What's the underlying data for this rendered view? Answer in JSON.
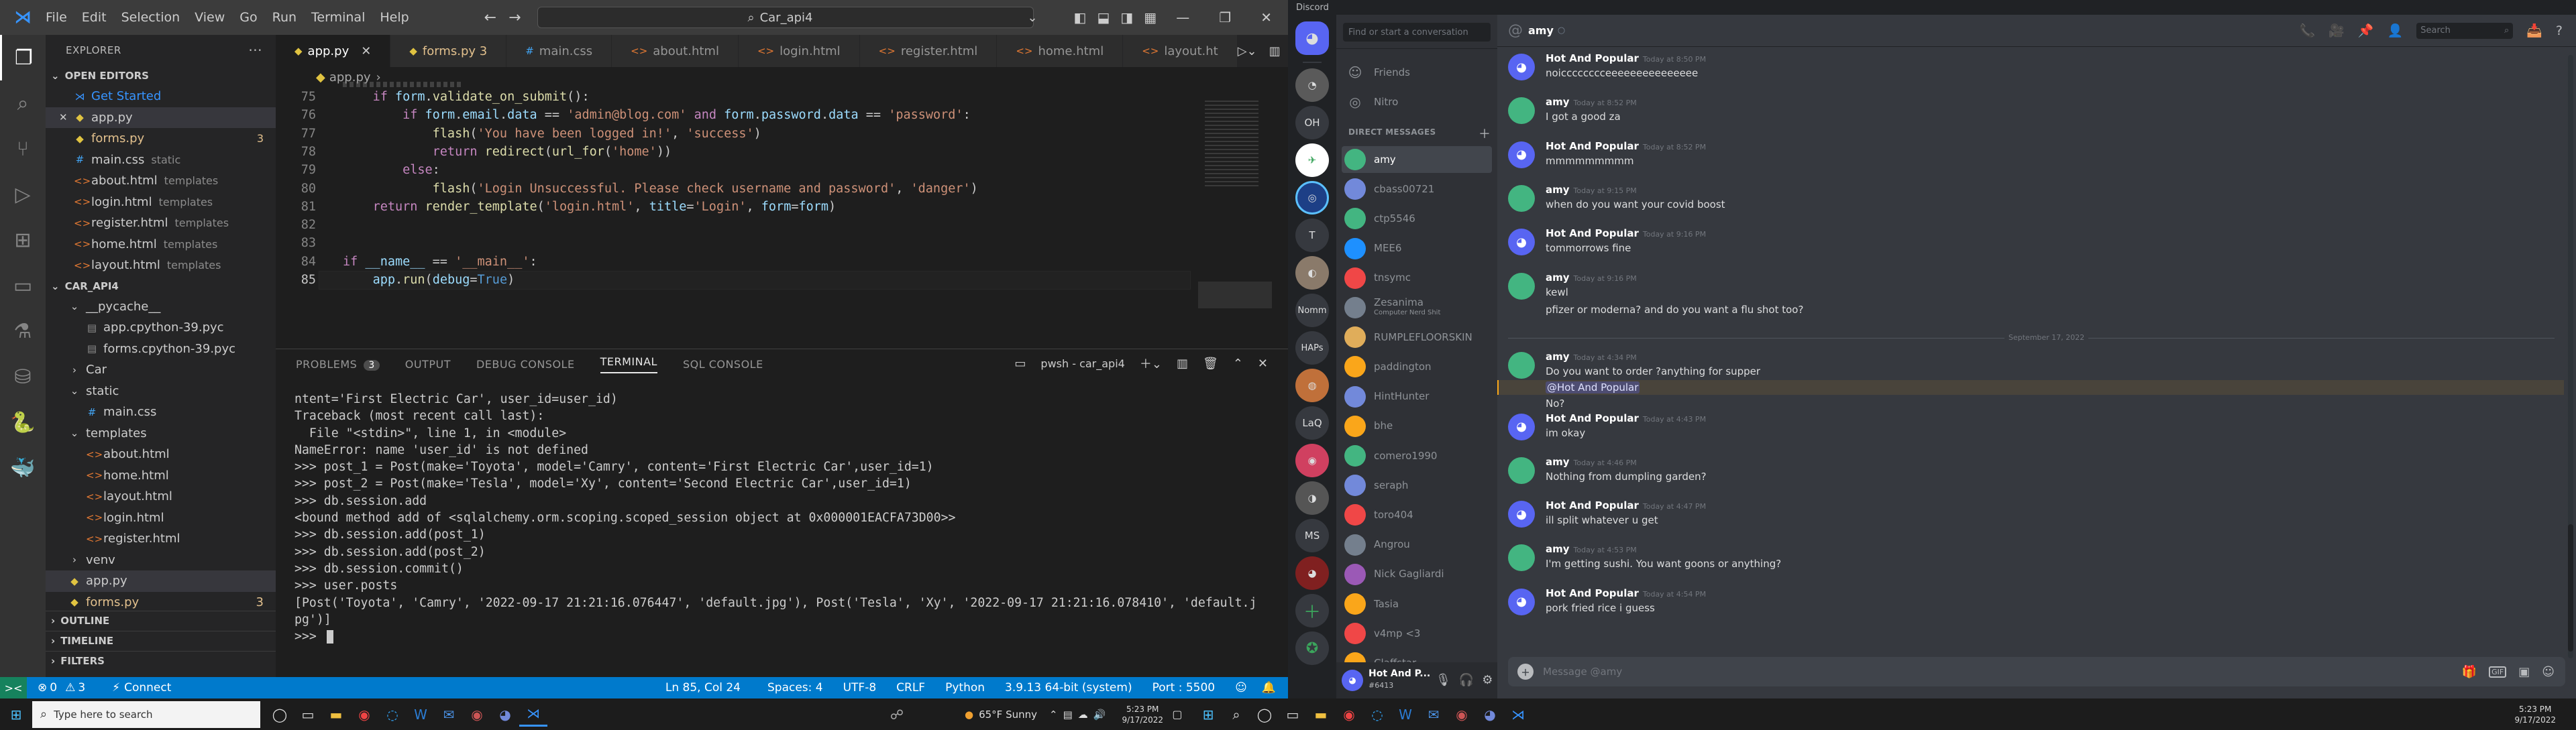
{
  "vscode": {
    "menu": [
      "File",
      "Edit",
      "Selection",
      "View",
      "Go",
      "Run",
      "Terminal",
      "Help"
    ],
    "search_text": "Car_api4",
    "explorer_title": "EXPLORER",
    "open_editors_label": "OPEN EDITORS",
    "open_editors": [
      {
        "name": "Get Started",
        "meta": "",
        "color": "#3794ff",
        "icon": "vscode-icon"
      },
      {
        "name": "app.py",
        "meta": "",
        "color": "#cccccc",
        "icon": "python-icon",
        "selected": true
      },
      {
        "name": "forms.py",
        "meta": "3",
        "color": "#e2c08d",
        "icon": "python-icon"
      },
      {
        "name": "main.css",
        "meta": "static",
        "color": "#cccccc",
        "icon": "css-icon"
      },
      {
        "name": "about.html",
        "meta": "templates",
        "color": "#cccccc",
        "icon": "html-icon"
      },
      {
        "name": "login.html",
        "meta": "templates",
        "color": "#cccccc",
        "icon": "html-icon"
      },
      {
        "name": "register.html",
        "meta": "templates",
        "color": "#cccccc",
        "icon": "html-icon"
      },
      {
        "name": "home.html",
        "meta": "templates",
        "color": "#cccccc",
        "icon": "html-icon"
      },
      {
        "name": "layout.html",
        "meta": "templates",
        "color": "#cccccc",
        "icon": "html-icon"
      }
    ],
    "project_label": "CAR_API4",
    "tree": [
      {
        "name": "__pycache__",
        "depth": 1,
        "type": "folder-open"
      },
      {
        "name": "app.cpython-39.pyc",
        "depth": 2,
        "type": "file"
      },
      {
        "name": "forms.cpython-39.pyc",
        "depth": 2,
        "type": "file"
      },
      {
        "name": "Car",
        "depth": 1,
        "type": "folder"
      },
      {
        "name": "static",
        "depth": 1,
        "type": "folder-open"
      },
      {
        "name": "main.css",
        "depth": 2,
        "type": "css"
      },
      {
        "name": "templates",
        "depth": 1,
        "type": "folder-open"
      },
      {
        "name": "about.html",
        "depth": 2,
        "type": "html"
      },
      {
        "name": "home.html",
        "depth": 2,
        "type": "html"
      },
      {
        "name": "layout.html",
        "depth": 2,
        "type": "html"
      },
      {
        "name": "login.html",
        "depth": 2,
        "type": "html"
      },
      {
        "name": "register.html",
        "depth": 2,
        "type": "html"
      },
      {
        "name": "venv",
        "depth": 1,
        "type": "folder"
      },
      {
        "name": "app.py",
        "depth": 1,
        "type": "python"
      },
      {
        "name": "forms.py",
        "depth": 1,
        "type": "python"
      }
    ],
    "outline_label": "OUTLINE",
    "timeline_label": "TIMELINE",
    "filters_label": "FILTERS",
    "tabs": [
      {
        "label": "app.py",
        "active": true,
        "icon": "python-icon"
      },
      {
        "label": "forms.py 3",
        "active": false,
        "icon": "python-icon"
      },
      {
        "label": "main.css",
        "active": false,
        "icon": "css-icon"
      },
      {
        "label": "about.html",
        "active": false,
        "icon": "html-icon"
      },
      {
        "label": "login.html",
        "active": false,
        "icon": "html-icon"
      },
      {
        "label": "register.html",
        "active": false,
        "icon": "html-icon"
      },
      {
        "label": "home.html",
        "active": false,
        "icon": "html-icon"
      },
      {
        "label": "layout.ht",
        "active": false,
        "icon": "html-icon"
      }
    ],
    "breadcrumb": "app.py",
    "code_lines": [
      {
        "n": "75",
        "t": "    if form.validate_on_submit():"
      },
      {
        "n": "76",
        "t": "        if form.email.data == 'admin@blog.com' and form.password.data == 'password':"
      },
      {
        "n": "77",
        "t": "            flash('You have been logged in!', 'success')"
      },
      {
        "n": "78",
        "t": "            return redirect(url_for('home'))"
      },
      {
        "n": "79",
        "t": "        else:"
      },
      {
        "n": "80",
        "t": "            flash('Login Unsuccessful. Please check username and password', 'danger')"
      },
      {
        "n": "81",
        "t": "    return render_template('login.html', title='Login', form=form)"
      },
      {
        "n": "82",
        "t": ""
      },
      {
        "n": "83",
        "t": ""
      },
      {
        "n": "84",
        "t": "if __name__ == '__main__':"
      },
      {
        "n": "85",
        "t": "    app.run(debug=True)"
      }
    ],
    "panel_tabs": [
      "PROBLEMS",
      "OUTPUT",
      "DEBUG CONSOLE",
      "TERMINAL",
      "SQL CONSOLE"
    ],
    "problems_count": "3",
    "terminal_name": "pwsh - car_api4",
    "terminal_lines": [
      "ntent='First Electric Car', user_id=user_id)",
      "Traceback (most recent call last):",
      "  File \"<stdin>\", line 1, in <module>",
      "NameError: name 'user_id' is not defined",
      ">>> post_1 = Post(make='Toyota', model='Camry', content='First Electric Car',user_id=1)",
      ">>> post_2 = Post(make='Tesla', model='Xy', content='Second Electric Car',user_id=1)",
      ">>> db.session.add",
      "<bound method add of <sqlalchemy.orm.scoping.scoped_session object at 0x000001EACFA73D00>>",
      ">>> db.session.add(post_1)",
      ">>> db.session.add(post_2)",
      ">>> db.session.commit()",
      ">>> user.posts",
      "[Post('Toyota', 'Camry', '2022-09-17 21:21:16.076447', 'default.jpg'), Post('Tesla', 'Xy', '2022-09-17 21:21:16.078410', 'default.j",
      "pg')]",
      ">>> "
    ],
    "status": {
      "remote": "><",
      "errors": "0",
      "warnings": "3",
      "connect": "Connect",
      "position": "Ln 85, Col 24",
      "spaces": "Spaces: 4",
      "encoding": "UTF-8",
      "eol": "CRLF",
      "language": "Python",
      "interpreter": "3.9.13 64-bit (system)",
      "port": "Port : 5500"
    }
  },
  "discord": {
    "app_title": "Discord",
    "search_placeholder": "Find or start a conversation",
    "friends": "Friends",
    "nitro": "Nitro",
    "dm_header": "DIRECT MESSAGES",
    "dms": [
      {
        "name": "amy",
        "color": "#43b581",
        "active": true
      },
      {
        "name": "cbass00721",
        "color": "#7289da"
      },
      {
        "name": "ctp5546",
        "color": "#43b581"
      },
      {
        "name": "MEE6",
        "color": "#1e90ff"
      },
      {
        "name": "tnsymc",
        "color": "#f04747"
      },
      {
        "name": "Zesanima",
        "sub": "Computer Nerd Shit",
        "color": "#747f8d"
      },
      {
        "name": "RUMPLEFLOORSKIN",
        "color": "#e0ad5a"
      },
      {
        "name": "paddington",
        "color": "#faa61a"
      },
      {
        "name": "HintHunter",
        "color": "#7289da"
      },
      {
        "name": "bhe",
        "color": "#faa61a"
      },
      {
        "name": "comero1990",
        "color": "#43b581"
      },
      {
        "name": "seraph",
        "color": "#7289da"
      },
      {
        "name": "toro404",
        "color": "#f04747"
      },
      {
        "name": "Angrou",
        "color": "#747f8d"
      },
      {
        "name": "Nick Gagliardi",
        "color": "#9b59b6"
      },
      {
        "name": "Tasia",
        "color": "#faa61a"
      },
      {
        "name": "v4mp <3",
        "color": "#f04747"
      },
      {
        "name": "Claffstar",
        "color": "#faa61a"
      }
    ],
    "servers": [
      "OH",
      "T",
      "Nomm",
      "HAPs",
      "LaQ",
      "MS"
    ],
    "user": {
      "name": "Hot And P...",
      "tag": "#6413"
    },
    "chat_title": "amy",
    "header_search": "Search",
    "date_divider": "September 17, 2022",
    "messages": [
      {
        "author": "Hot And Popular",
        "time": "Today at 8:50 PM",
        "text": "noicccccccceeeeeeeeeeeeeee",
        "avatar": "#5865f2",
        "bot": true
      },
      {
        "author": "amy",
        "time": "Today at 8:52 PM",
        "text": "I got a good za",
        "avatar": "#43b581"
      },
      {
        "author": "Hot And Popular",
        "time": "Today at 8:52 PM",
        "text": "mmmmmmmmm",
        "avatar": "#5865f2",
        "bot": true
      },
      {
        "author": "amy",
        "time": "Today at 9:15 PM",
        "text": "when do you want your covid boost",
        "avatar": "#43b581"
      },
      {
        "author": "Hot And Popular",
        "time": "Today at 9:16 PM",
        "text": "tommorrows fine",
        "avatar": "#5865f2",
        "bot": true
      },
      {
        "author": "amy",
        "time": "Today at 9:16 PM",
        "text": "kewl",
        "text2": "pfizer or moderna?  and do you want a flu shot too?",
        "avatar": "#43b581"
      },
      {
        "author": "amy",
        "time": "Today at 4:34 PM",
        "text": "Do you want to order ?anything for supper",
        "mention": "@Hot And Popular",
        "text3": "No?",
        "avatar": "#43b581"
      },
      {
        "author": "Hot And Popular",
        "time": "Today at 4:43 PM",
        "text": "im okay",
        "avatar": "#5865f2",
        "bot": true
      },
      {
        "author": "amy",
        "time": "Today at 4:46 PM",
        "text": "Nothing from dumpling garden?",
        "avatar": "#43b581"
      },
      {
        "author": "Hot And Popular",
        "time": "Today at 4:47 PM",
        "text": "ill split whatever u get",
        "avatar": "#5865f2",
        "bot": true
      },
      {
        "author": "amy",
        "time": "Today at 4:53 PM",
        "text": "I'm getting sushi. You want goons or anything?",
        "avatar": "#43b581"
      },
      {
        "author": "Hot And Popular",
        "time": "Today at 4:54 PM",
        "text": "pork fried rice i guess",
        "avatar": "#5865f2",
        "bot": true
      }
    ],
    "input_placeholder": "Message @amy"
  },
  "taskbar": {
    "search_placeholder": "Type here to search",
    "weather": "65°F  Sunny",
    "time_left": "5:23 PM",
    "date_left": "9/17/2022",
    "time_right": "5:23 PM",
    "date_right": "9/17/2022"
  }
}
